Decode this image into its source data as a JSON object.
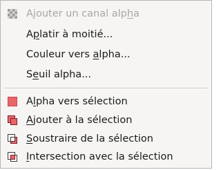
{
  "menu": {
    "items": [
      {
        "pre": "Ajouter un canal alp",
        "key": "h",
        "post": "a",
        "icon": "alpha-channel-checker-icon",
        "enabled": false
      },
      {
        "pre": "A",
        "key": "p",
        "post": "latir à moitié...",
        "icon": "",
        "enabled": true
      },
      {
        "pre": "Couleur vers ",
        "key": "a",
        "post": "lpha...",
        "icon": "",
        "enabled": true
      },
      {
        "pre": "S",
        "key": "e",
        "post": "uil alpha...",
        "icon": "",
        "enabled": true
      },
      {
        "pre": "A",
        "key": "l",
        "post": "pha vers sélection",
        "icon": "selection-replace-icon",
        "enabled": true
      },
      {
        "pre": "",
        "key": "A",
        "post": "jouter à la sélection",
        "icon": "selection-add-icon",
        "enabled": true
      },
      {
        "pre": "",
        "key": "S",
        "post": "oustraire de la sélection",
        "icon": "selection-subtract-icon",
        "enabled": true
      },
      {
        "pre": "",
        "key": "I",
        "post": "ntersection avec la sélection",
        "icon": "selection-intersect-icon",
        "enabled": true
      }
    ]
  },
  "colors": {
    "selection_fill": "#e8656a",
    "selection_border": "#b8343a",
    "disabled_text": "#a9a7a3"
  }
}
